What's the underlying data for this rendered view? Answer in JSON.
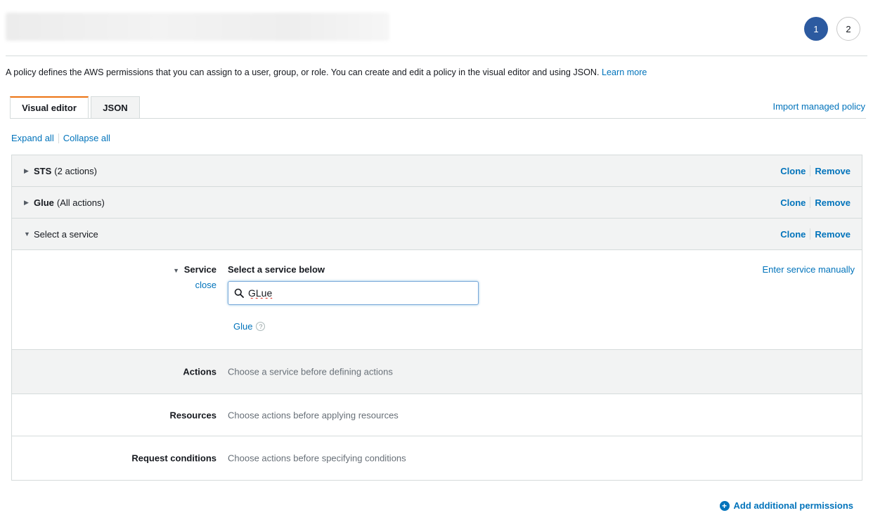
{
  "header": {
    "steps": [
      {
        "label": "1",
        "active": true
      },
      {
        "label": "2",
        "active": false
      }
    ]
  },
  "intro": {
    "text": "A policy defines the AWS permissions that you can assign to a user, group, or role. You can create and edit a policy in the visual editor and using JSON.",
    "learn_more": "Learn more"
  },
  "tabs": [
    {
      "label": "Visual editor",
      "active": true
    },
    {
      "label": "JSON",
      "active": false
    }
  ],
  "import_link": "Import managed policy",
  "expand_all": "Expand all",
  "collapse_all": "Collapse all",
  "sections": [
    {
      "service": "STS",
      "detail": "(2 actions)",
      "clone": "Clone",
      "remove": "Remove"
    },
    {
      "service": "Glue",
      "detail": "(All actions)",
      "clone": "Clone",
      "remove": "Remove"
    },
    {
      "service": "",
      "detail": "Select a service",
      "clone": "Clone",
      "remove": "Remove"
    }
  ],
  "service_panel": {
    "label": "Service",
    "close": "close",
    "heading": "Select a service below",
    "manual_link": "Enter service manually",
    "search_value": "GLue",
    "result": "Glue"
  },
  "rows": [
    {
      "label": "Actions",
      "value": "Choose a service before defining actions"
    },
    {
      "label": "Resources",
      "value": "Choose actions before applying resources"
    },
    {
      "label": "Request conditions",
      "value": "Choose actions before specifying conditions"
    }
  ],
  "add_permissions": "Add additional permissions",
  "colors": {
    "link": "#0073bb",
    "step_active": "#2c5aa0",
    "tab_accent": "#ec7211",
    "section_bg": "#f2f3f3"
  }
}
